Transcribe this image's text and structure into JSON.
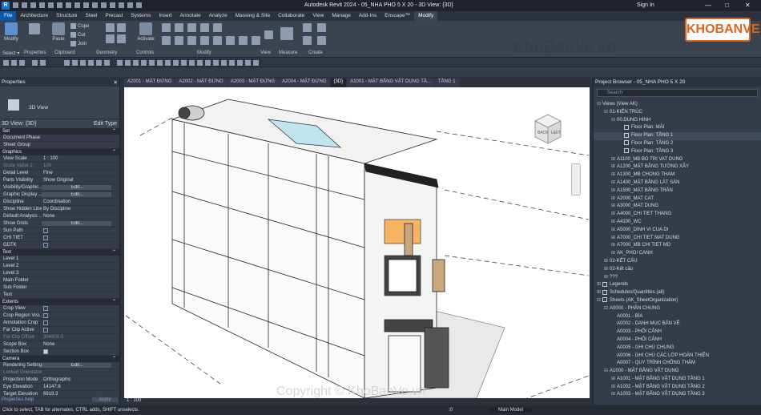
{
  "titlebar": {
    "logo": "R",
    "title": "Autodesk Revit 2024 - 05_NHA PHO 5 X 20 - 3D View: {3D}",
    "signin": "Sign In",
    "min": "—",
    "max": "□",
    "close": "✕"
  },
  "ribbon_tabs": [
    "File",
    "Architecture",
    "Structure",
    "Steel",
    "Precast",
    "Systems",
    "Insert",
    "Annotate",
    "Analyze",
    "Massing & Site",
    "Collaborate",
    "View",
    "Manage",
    "Add-Ins",
    "Enscape™",
    "Modify"
  ],
  "ribbon": {
    "modify": "Modify",
    "paste": "Paste",
    "cope": "Cope",
    "cut": "Cut",
    "join": "Join",
    "activate": "Activate",
    "groups": {
      "select": "Select ▾",
      "properties": "Properties",
      "clipboard": "Clipboard",
      "geometry": "Geometry",
      "controls": "Controls",
      "modify": "Modify",
      "view": "View",
      "measure": "Measure",
      "create": "Create"
    }
  },
  "properties": {
    "header": "Properties",
    "close": "✕",
    "type_name": "3D View",
    "selector": "3D View: {3D}",
    "edit_type": "Edit Type",
    "sections": [
      {
        "name": "Set",
        "rows": [
          {
            "k": "Document Phase",
            "v": ""
          },
          {
            "k": "Sheet Group",
            "v": ""
          }
        ]
      },
      {
        "name": "Graphics",
        "rows": [
          {
            "k": "View Scale",
            "v": "1 : 100"
          },
          {
            "k": "Scale Value 1:",
            "v": "100",
            "dis": true
          },
          {
            "k": "Detail Level",
            "v": "Fine"
          },
          {
            "k": "Parts Visibility",
            "v": "Show Original"
          },
          {
            "k": "Visibility/Graphic...",
            "v": "Edit...",
            "btn": true
          },
          {
            "k": "Graphic Display ...",
            "v": "Edit...",
            "btn": true
          },
          {
            "k": "Discipline",
            "v": "Coordination"
          },
          {
            "k": "Show Hidden Lines",
            "v": "By Discipline"
          },
          {
            "k": "Default Analysis ...",
            "v": "None"
          },
          {
            "k": "Show Grids",
            "v": "Edit...",
            "btn": true
          },
          {
            "k": "Sun Path",
            "v": "",
            "cb": false
          },
          {
            "k": "CHI TIẾT",
            "v": "",
            "cb": false
          },
          {
            "k": "GDTK",
            "v": "",
            "cb": false
          }
        ]
      },
      {
        "name": "Text",
        "rows": [
          {
            "k": "Level 1",
            "v": ""
          },
          {
            "k": "Level 2",
            "v": ""
          },
          {
            "k": "Level 3",
            "v": ""
          },
          {
            "k": "Main Folder",
            "v": ""
          },
          {
            "k": "Sub Folder",
            "v": ""
          },
          {
            "k": "Text",
            "v": ""
          }
        ]
      },
      {
        "name": "Extents",
        "rows": [
          {
            "k": "Crop View",
            "v": "",
            "cb": false
          },
          {
            "k": "Crop Region Visi...",
            "v": "",
            "cb": false
          },
          {
            "k": "Annotation Crop",
            "v": "",
            "cb": false
          },
          {
            "k": "Far Clip Active",
            "v": "",
            "cb": false
          },
          {
            "k": "Far Clip Offset",
            "v": "304800.0",
            "dis": true
          },
          {
            "k": "Scope Box",
            "v": "None"
          },
          {
            "k": "Section Box",
            "v": "",
            "cb": true
          }
        ]
      },
      {
        "name": "Camera",
        "rows": [
          {
            "k": "Rendering Settings",
            "v": "Edit...",
            "btn": true
          },
          {
            "k": "Locked Orientation",
            "v": "",
            "dis": true
          },
          {
            "k": "Projection Mode",
            "v": "Orthographic"
          },
          {
            "k": "Eye Elevation",
            "v": "14147.8"
          },
          {
            "k": "Target Elevation",
            "v": "6919.3"
          }
        ]
      }
    ],
    "help": "Properties help",
    "apply": "Apply"
  },
  "view_tabs": [
    {
      "label": "A2001 - MẶT ĐỨNG"
    },
    {
      "label": "A2002 - MẶT ĐỨNG"
    },
    {
      "label": "A2003 - MẶT ĐỨNG"
    },
    {
      "label": "A2004 - MẶT ĐỨNG"
    },
    {
      "label": "{3D}",
      "active": true
    },
    {
      "label": "A1001 - MẶT BẰNG VẬT DỤNG TẦ..."
    },
    {
      "label": "TẦNG 1"
    }
  ],
  "viewcube": {
    "front": "BACK",
    "right": "LEFT"
  },
  "view_control": {
    "scale": "1 : 100"
  },
  "browser": {
    "header": "Project Browser - 05_NHA PHO 5 X 20",
    "search_placeholder": "Search",
    "items": [
      {
        "t": "Views (View AK)",
        "lvl": 0,
        "tg": "⊟"
      },
      {
        "t": "01-KIẾN TRÚC",
        "lvl": 1,
        "tg": "⊟"
      },
      {
        "t": "00.DUNG HINH",
        "lvl": 2,
        "tg": "⊟"
      },
      {
        "t": "Floor Plan: MÁI",
        "lvl": 3,
        "sq": true
      },
      {
        "t": "Floor Plan: TẦNG 1",
        "lvl": 3,
        "sq": true,
        "sel": true
      },
      {
        "t": "Floor Plan: TẦNG 2",
        "lvl": 3,
        "sq": true
      },
      {
        "t": "Floor Plan: TẦNG 3",
        "lvl": 3,
        "sq": true
      },
      {
        "t": "A1100_MB BO TRI VAT DUNG",
        "lvl": 2,
        "tg": "⊞"
      },
      {
        "t": "A1200_MẶT BẰNG TƯỜNG XÂY",
        "lvl": 2,
        "tg": "⊞"
      },
      {
        "t": "A1300_MB CHONG THAM",
        "lvl": 2,
        "tg": "⊞"
      },
      {
        "t": "A1400_MẶT BẰNG LÁT SÀN",
        "lvl": 2,
        "tg": "⊞"
      },
      {
        "t": "A1500_MẶT BẰNG TRẦN",
        "lvl": 2,
        "tg": "⊞"
      },
      {
        "t": "A2000_MAT CAT",
        "lvl": 2,
        "tg": "⊞"
      },
      {
        "t": "A3000_MAT DUNG",
        "lvl": 2,
        "tg": "⊞"
      },
      {
        "t": "A4000_CHI TIET THANG",
        "lvl": 2,
        "tg": "⊞"
      },
      {
        "t": "A4100_WC",
        "lvl": 2,
        "tg": "⊞"
      },
      {
        "t": "A5000_DINH VI CUA DI",
        "lvl": 2,
        "tg": "⊞"
      },
      {
        "t": "A7000_CHI TIET MAT DUNG",
        "lvl": 2,
        "tg": "⊞"
      },
      {
        "t": "A7000_MB CHI TIET MD",
        "lvl": 2,
        "tg": "⊞"
      },
      {
        "t": "AK_PHOI CANH",
        "lvl": 2,
        "tg": "⊞"
      },
      {
        "t": "02-KẾT CẤU",
        "lvl": 1,
        "tg": "⊞"
      },
      {
        "t": "02-Kết cấu",
        "lvl": 1,
        "tg": "⊞"
      },
      {
        "t": "???",
        "lvl": 1,
        "tg": "⊞"
      },
      {
        "t": "Legends",
        "lvl": 0,
        "tg": "⊞",
        "sq": true
      },
      {
        "t": "Schedules/Quantities (all)",
        "lvl": 0,
        "tg": "⊞",
        "sq": true
      },
      {
        "t": "Sheets (AK_SheetOrganization)",
        "lvl": 0,
        "tg": "⊟",
        "sq": true
      },
      {
        "t": "A0000 - PHẦN CHUNG",
        "lvl": 1,
        "tg": "⊟"
      },
      {
        "t": "A0001 - BÌA",
        "lvl": 2
      },
      {
        "t": "A0002 - DANH MỤC BẢN VẼ",
        "lvl": 2
      },
      {
        "t": "A0003 - PHỐI CẢNH",
        "lvl": 2
      },
      {
        "t": "A0004 - PHỐI CẢNH",
        "lvl": 2
      },
      {
        "t": "A0005 - GHI CHÚ CHUNG",
        "lvl": 2
      },
      {
        "t": "A0006 - GHI CHÚ CÁC LỚP HOÀN THIỆN",
        "lvl": 2
      },
      {
        "t": "A0007 - QUY TRÌNH CHỐNG THẤM",
        "lvl": 2
      },
      {
        "t": "A1000 - MẶT BẰNG VẬT DỤNG",
        "lvl": 1,
        "tg": "⊟"
      },
      {
        "t": "A1001 - MẶT BẰNG VẬT DỤNG TẦNG 1",
        "lvl": 2,
        "tg": "⊞"
      },
      {
        "t": "A1002 - MẶT BẰNG VẬT DỤNG TẦNG 2",
        "lvl": 2,
        "tg": "⊞"
      },
      {
        "t": "A1003 - MẶT BẰNG VẬT DỤNG TẦNG 3",
        "lvl": 2,
        "tg": "⊞"
      }
    ]
  },
  "status": {
    "left": "Click to select, TAB for alternates, CTRL adds, SHIFT unselects.",
    "zero": ":0",
    "model": "Main Model"
  },
  "watermark": {
    "site": "KhoBanVe.vn",
    "copyright": "Copyright © KhoBanVe.vn",
    "logo": "KHOBANVE"
  }
}
